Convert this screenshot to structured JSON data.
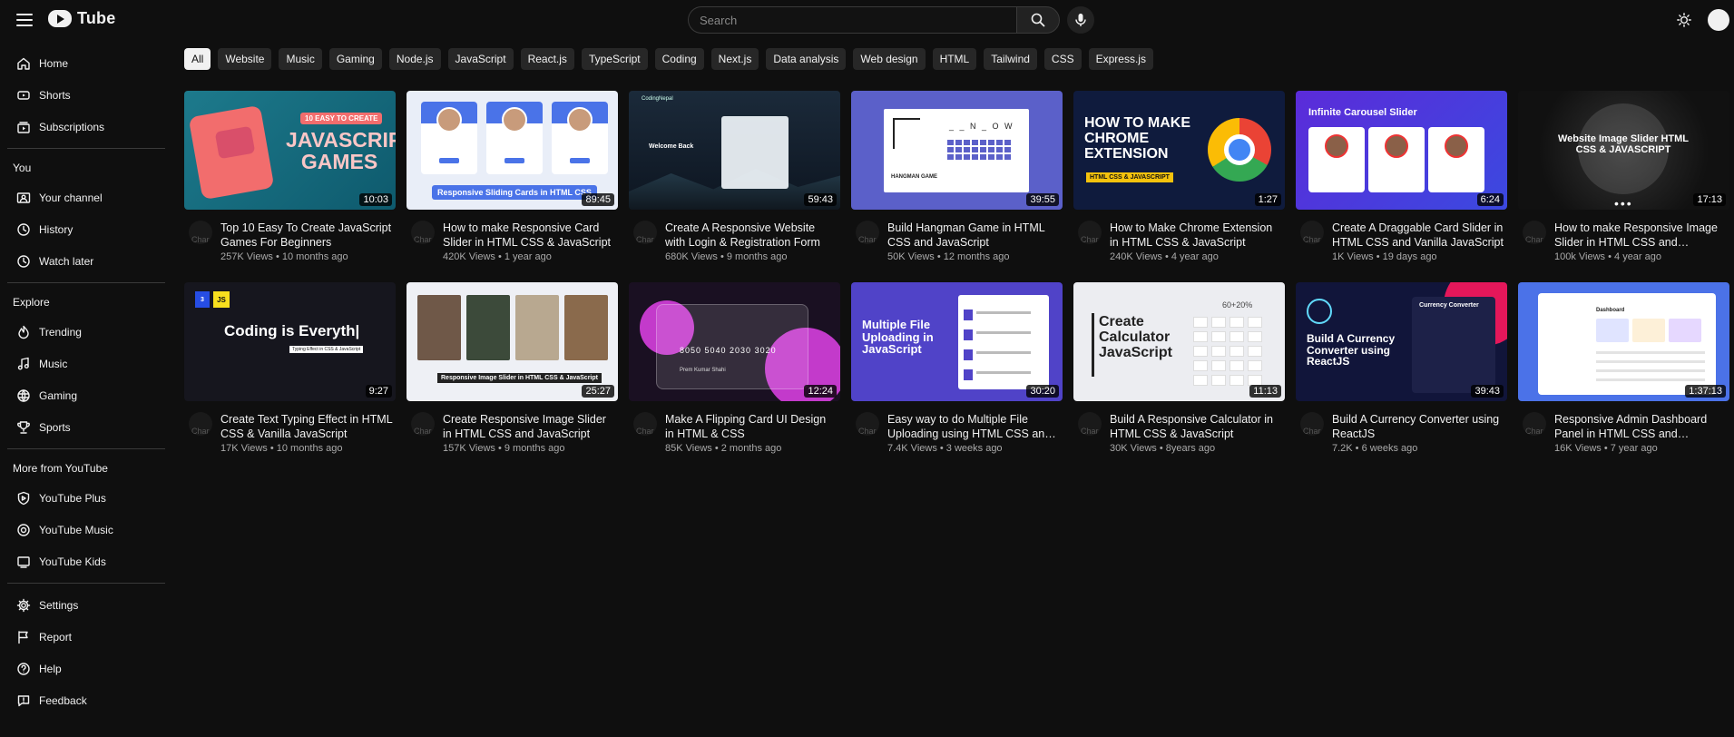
{
  "header": {
    "logo_text": "Tube",
    "search_placeholder": "Search"
  },
  "sidebar": {
    "main": [
      {
        "label": "Home",
        "icon": "home-icon"
      },
      {
        "label": "Shorts",
        "icon": "shorts-icon"
      },
      {
        "label": "Subscriptions",
        "icon": "subscriptions-icon"
      }
    ],
    "you_heading": "You",
    "you": [
      {
        "label": "Your channel",
        "icon": "channel-icon"
      },
      {
        "label": "History",
        "icon": "history-icon"
      },
      {
        "label": "Watch later",
        "icon": "clock-icon"
      }
    ],
    "explore_heading": "Explore",
    "explore": [
      {
        "label": "Trending",
        "icon": "trending-icon"
      },
      {
        "label": "Music",
        "icon": "music-icon"
      },
      {
        "label": "Gaming",
        "icon": "gaming-icon"
      },
      {
        "label": "Sports",
        "icon": "trophy-icon"
      }
    ],
    "more_heading": "More from YouTube",
    "more": [
      {
        "label": "YouTube Plus",
        "icon": "plus-shield-icon"
      },
      {
        "label": "YouTube Music",
        "icon": "music-circle-icon"
      },
      {
        "label": "YouTube Kids",
        "icon": "kids-icon"
      }
    ],
    "bottom": [
      {
        "label": "Settings",
        "icon": "gear-icon"
      },
      {
        "label": "Report",
        "icon": "flag-icon"
      },
      {
        "label": "Help",
        "icon": "help-icon"
      },
      {
        "label": "Feedback",
        "icon": "feedback-icon"
      }
    ]
  },
  "chips": [
    "All",
    "Website",
    "Music",
    "Gaming",
    "Node.js",
    "JavaScript",
    "React.js",
    "TypeScript",
    "Coding",
    "Next.js",
    "Data analysis",
    "Web design",
    "HTML",
    "Tailwind",
    "CSS",
    "Express.js"
  ],
  "avatar_alt": "Char",
  "videos": [
    {
      "title": "Top 10 Easy To Create JavaScript Games For Beginners",
      "stats": "257K Views • 10 months ago",
      "duration": "10:03",
      "thumb_text": "JAVASCRIPT GAMES",
      "thumb_sub": "10 EASY TO CREATE"
    },
    {
      "title": "How to make Responsive Card Slider in HTML CSS & JavaScript",
      "stats": "420K Views • 1 year ago",
      "duration": "89:45",
      "thumb_text": "Responsive Sliding Cards in HTML CSS",
      "thumb_sub": ""
    },
    {
      "title": "Create A Responsive Website with Login & Registration Form",
      "stats": "680K Views • 9 months ago",
      "duration": "59:43",
      "thumb_text": "Welcome Back",
      "thumb_sub": "CodingNepal"
    },
    {
      "title": "Build Hangman Game in HTML CSS and JavaScript",
      "stats": "50K Views • 12 months ago",
      "duration": "39:55",
      "thumb_text": "HANGMAN GAME",
      "thumb_sub": "_ _ N _ O W"
    },
    {
      "title": "How to Make Chrome Extension in HTML CSS & JavaScript",
      "stats": "240K Views • 4 year ago",
      "duration": "1:27",
      "thumb_text": "HOW TO MAKE CHROME EXTENSION",
      "thumb_sub": "HTML CSS & JAVASCRIPT"
    },
    {
      "title": "Create A Draggable Card Slider in HTML CSS and Vanilla JavaScript",
      "stats": "1K Views • 19 days ago",
      "duration": "6:24",
      "thumb_text": "Infinite Carousel Slider",
      "thumb_sub": ""
    },
    {
      "title": "How to make Responsive Image Slider in HTML CSS and JavaScript",
      "stats": "100k Views • 4 year ago",
      "duration": "17:13",
      "thumb_text": "Website Image Slider HTML CSS & JAVASCRIPT",
      "thumb_sub": ""
    },
    {
      "title": "Create Text Typing Effect in HTML CSS & Vanilla JavaScript",
      "stats": "17K Views • 10 months ago",
      "duration": "9:27",
      "thumb_text": "Coding is Everyth|",
      "thumb_sub": "Typing Effect in CSS & JavaScript"
    },
    {
      "title": "Create Responsive Image Slider in HTML CSS and JavaScript",
      "stats": "157K Views • 9 months ago",
      "duration": "25:27",
      "thumb_text": "Responsive Image Slider in HTML CSS & JavaScript",
      "thumb_sub": ""
    },
    {
      "title": "Make A Flipping Card UI Design in HTML & CSS",
      "stats": "85K Views • 2 months ago",
      "duration": "12:24",
      "thumb_text": "8050 5040 2030 3020",
      "thumb_sub": "Prem Kumar Shahi"
    },
    {
      "title": "Easy way to do Multiple File Uploading using HTML CSS and JavaScript",
      "stats": "7.4K Views • 3 weeks ago",
      "duration": "30:20",
      "thumb_text": "Multiple File Uploading in JavaScript",
      "thumb_sub": ""
    },
    {
      "title": "Build A Responsive Calculator in HTML CSS & JavaScript",
      "stats": "30K Views • 8years ago",
      "duration": "11:13",
      "thumb_text": "Create Calculator JavaScript",
      "thumb_sub": "60+20%"
    },
    {
      "title": "Build A Currency Converter using ReactJS",
      "stats": "7.2K • 6 weeks ago",
      "duration": "39:43",
      "thumb_text": "Build A Currency Converter using ReactJS",
      "thumb_sub": "Currency Converter"
    },
    {
      "title": "Responsive Admin Dashboard Panel in HTML CSS and JavaScript",
      "stats": "16K Views • 7 year ago",
      "duration": "1:37:13",
      "thumb_text": "Dashboard",
      "thumb_sub": ""
    }
  ],
  "colors": {
    "background": "#0f0f0f",
    "chip": "#272727",
    "chip_active": "#f1f1f1",
    "text": "#f1f1f1",
    "muted": "#aaaaaa"
  }
}
